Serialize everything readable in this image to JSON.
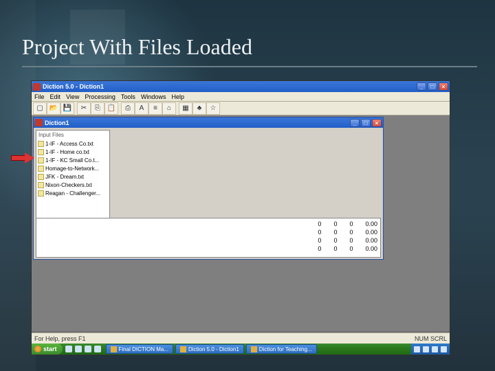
{
  "slide": {
    "title": "Project With Files Loaded"
  },
  "app": {
    "title": "Diction 5.0 - Diction1",
    "menu": {
      "file": "File",
      "edit": "Edit",
      "view": "View",
      "processing": "Processing",
      "tools": "Tools",
      "windows": "Windows",
      "help": "Help"
    }
  },
  "inner": {
    "title": "Diction1",
    "panel_title": "Input Files",
    "files": [
      "1-IF - Access Co.txt",
      "1-IF - Home co.txt",
      "1-IF - KC Small Co.t...",
      "Homage-to-Network...",
      "JFK - Dream.txt",
      "Nixon-Checkers.txt",
      "Reagan - Challenger..."
    ]
  },
  "grid": {
    "col1": [
      "0",
      "0",
      "0",
      "0"
    ],
    "col2": [
      "0",
      "0",
      "0",
      "0"
    ],
    "col3": [
      "0",
      "0",
      "0",
      "0"
    ],
    "col4": [
      "0.00",
      "0.00",
      "0.00",
      "0.00"
    ]
  },
  "status": {
    "left": "For Help, press F1",
    "right": "NUM SCRL"
  },
  "taskbar": {
    "start": "start",
    "buttons": [
      "Final DICTION Ma...",
      "Diction 5.0 - Diction1",
      "Diction for Teaching..."
    ]
  }
}
